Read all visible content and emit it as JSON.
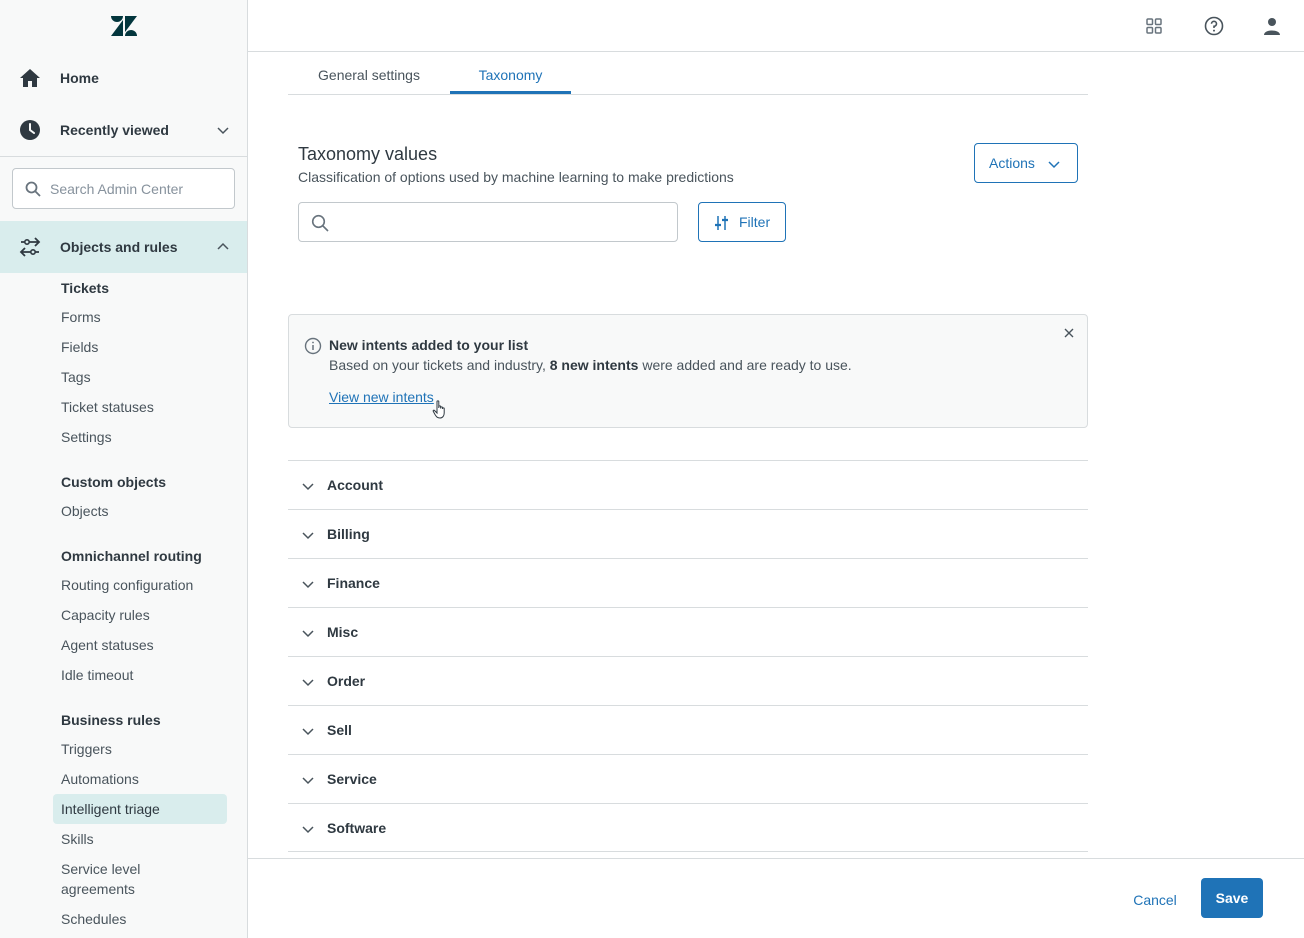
{
  "sidebar": {
    "logo_icon": "zendesk-logo",
    "home_label": "Home",
    "recent_label": "Recently viewed",
    "search_placeholder": "Search Admin Center",
    "objects_label": "Objects and rules",
    "sections": [
      {
        "heading": "Tickets",
        "items": [
          "Forms",
          "Fields",
          "Tags",
          "Ticket statuses",
          "Settings"
        ]
      },
      {
        "heading": "Custom objects",
        "items": [
          "Objects"
        ]
      },
      {
        "heading": "Omnichannel routing",
        "items": [
          "Routing configuration",
          "Capacity rules",
          "Agent statuses",
          "Idle timeout"
        ]
      },
      {
        "heading": "Business rules",
        "items": [
          "Triggers",
          "Automations",
          "Intelligent triage",
          "Skills",
          "Service level",
          "agreements",
          "Schedules"
        ]
      }
    ],
    "active_item": "Intelligent triage"
  },
  "topbar": {
    "icons": [
      "apps-grid-icon",
      "help-icon",
      "user-icon"
    ]
  },
  "tabs": [
    "General settings",
    "Taxonomy"
  ],
  "active_tab": "Taxonomy",
  "main": {
    "title": "Taxonomy values",
    "subtitle": "Classification of options used by machine learning to make predictions",
    "actions_label": "Actions",
    "search_value": "",
    "filter_label": "Filter"
  },
  "alert": {
    "title": "New intents added to your list",
    "body_pre": "Based on your tickets and industry, ",
    "body_bold": "8 new intents",
    "body_post": " were added and are ready to use.",
    "link": "View new intents"
  },
  "categories": [
    "Account",
    "Billing",
    "Finance",
    "Misc",
    "Order",
    "Sell",
    "Service",
    "Software"
  ],
  "footer": {
    "cancel_label": "Cancel",
    "save_label": "Save"
  },
  "colors": {
    "accent": "#1f73b7",
    "selected_bg": "#d9eded",
    "text": "#2f3941"
  }
}
